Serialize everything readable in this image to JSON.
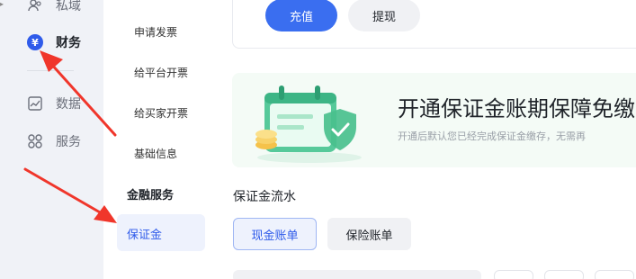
{
  "rail": {
    "items": [
      {
        "label": "私域",
        "icon": "user-group-icon"
      },
      {
        "label": "财务",
        "icon": "yen-icon",
        "glyph": "¥"
      },
      {
        "label": "数据",
        "icon": "chart-icon"
      },
      {
        "label": "服务",
        "icon": "grid-icon"
      }
    ]
  },
  "submenu": {
    "items": [
      "申请发票",
      "给平台开票",
      "给买家开票",
      "基础信息"
    ],
    "group_title": "金融服务",
    "active_item": "保证金"
  },
  "main": {
    "recharge_label": "充值",
    "withdraw_label": "提现",
    "banner_title": "开通保证金账期保障免缴",
    "banner_desc": "开通后默认您已经完成保证金缴存，无需再",
    "section_title": "保证金流水",
    "tabs": [
      {
        "label": "现金账单",
        "active": true
      },
      {
        "label": "保险账单",
        "active": false
      }
    ]
  },
  "colors": {
    "primary": "#3a6ef0",
    "annotation_arrow": "#f0362b",
    "illustration_green": "#3cc28a"
  }
}
